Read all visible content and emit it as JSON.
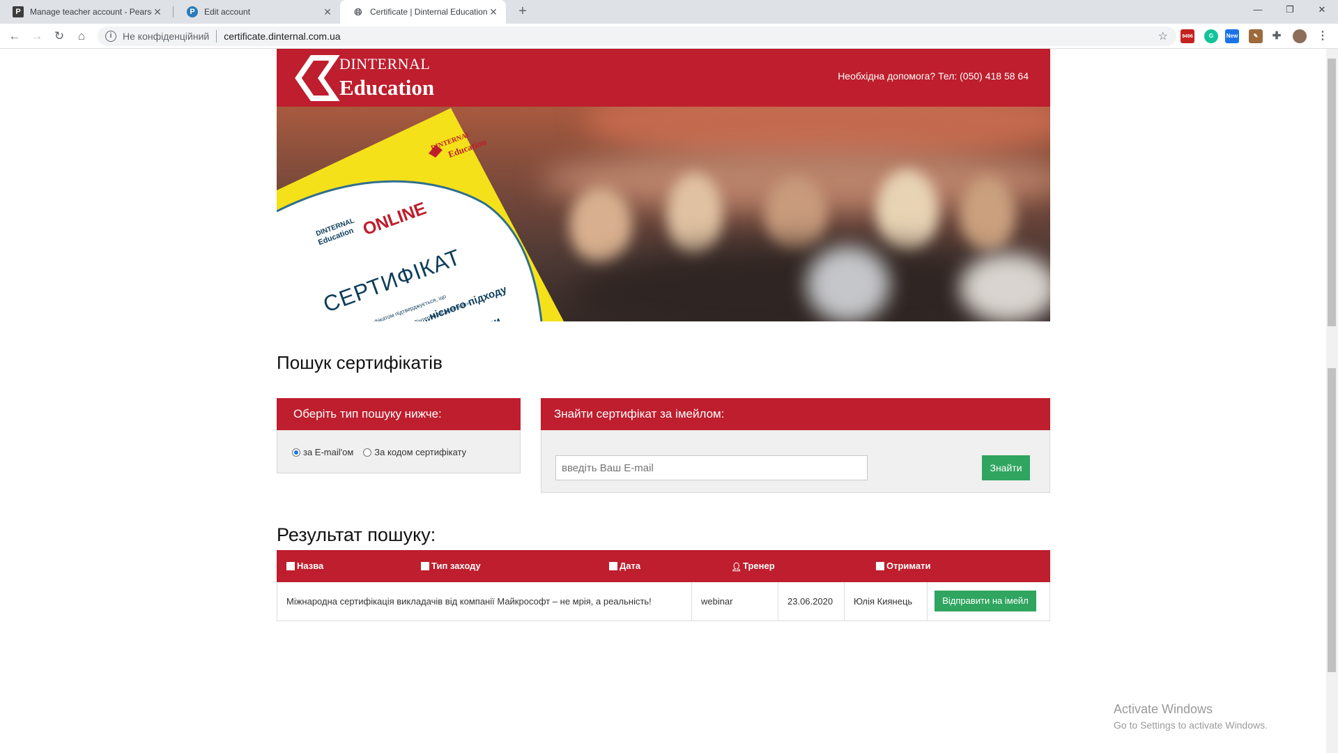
{
  "browser": {
    "tabs": [
      {
        "title": "Manage teacher account - Pearso",
        "favicon": "P"
      },
      {
        "title": "Edit account",
        "favicon": "P"
      },
      {
        "title": "Certificate | Dinternal Education",
        "favicon": "globe"
      }
    ],
    "security_label": "Не конфіденційний",
    "url": "certificate.dinternal.com.ua",
    "ext_badge": "9496",
    "ext_new": "New"
  },
  "site": {
    "brand_line1": "DINTERNAL",
    "brand_line2": "Education",
    "help_text": "Необхідна допомога? Тел: (050) 418 58 64"
  },
  "banner": {
    "cert_brand1": "DINTERNAL",
    "cert_brand2": "Education",
    "cert_online_brand": "DINTERNAL",
    "cert_online_brand2": "Education",
    "cert_online": "ONLINE",
    "cert_title": "СЕРТИФІКАТ",
    "cert_line1": "Цим сертифікатом підтверджується, що",
    "cert_line2": "тренінгу від ТОВ «Дінтернал Едюкейшн»",
    "cert_line3": "...нісного підходу",
    "cert_line4": "...мови"
  },
  "search": {
    "title": "Пошук сертифікатів",
    "type_panel_title": "Оберіть тип пошуку нижче:",
    "radio_email": "за E-mail'ом",
    "radio_code": "За кодом сертифікату",
    "email_panel_title": "Знайти сертифікат за імейлом:",
    "email_placeholder": "введіть Ваш E-mail",
    "find_button": "Знайти"
  },
  "results": {
    "title": "Результат пошуку:",
    "columns": [
      "Назва",
      "Тип заходу",
      "Дата",
      "Тренер",
      "Отримати"
    ],
    "rows": [
      {
        "name": "Міжнародна сертифікація викладачів від компанії Майкрософт – не мрія, а реальність!",
        "type": "webinar",
        "date": "23.06.2020",
        "trainer": "Юлія Киянець",
        "action": "Відправити на імейл"
      }
    ]
  },
  "windows_watermark": {
    "line1": "Activate Windows",
    "line2": "Go to Settings to activate Windows."
  },
  "colors": {
    "brand_red": "#be1e2d",
    "button_green": "#2fa560"
  }
}
